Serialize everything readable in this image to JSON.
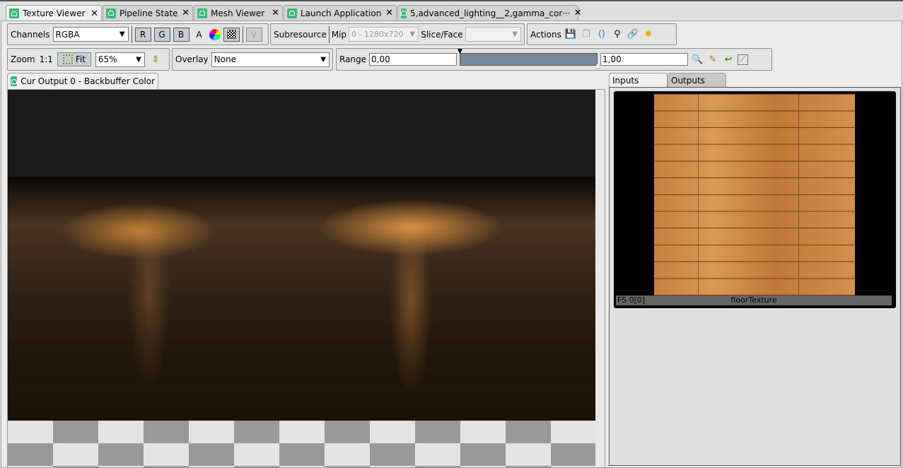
{
  "tabs": [
    {
      "label": "Texture Viewer",
      "active": true
    },
    {
      "label": "Pipeline State"
    },
    {
      "label": "Mesh Viewer"
    },
    {
      "label": "Launch Application"
    },
    {
      "label": "5,advanced_lighting__2,gamma_cor···"
    }
  ],
  "toolbar": {
    "channels_label": "Channels",
    "channels_value": "RGBA",
    "r": "R",
    "g": "G",
    "b": "B",
    "a": "A",
    "v": "v",
    "subresource_label": "Subresource",
    "mip_label": "Mip",
    "mip_value": "0 - 1280x720",
    "slice_label": "Slice/Face",
    "slice_value": "",
    "actions_label": "Actions",
    "zoom_label": "Zoom",
    "zoom_1to1": "1:1",
    "fit_label": "Fit",
    "zoom_value": "65%",
    "overlay_label": "Overlay",
    "overlay_value": "None",
    "range_label": "Range",
    "range_min": "0,00",
    "range_max": "1,00"
  },
  "viewer": {
    "tab_label": "Cur Output 0 - Backbuffer Color"
  },
  "side": {
    "tab_inputs": "Inputs",
    "tab_outputs": "Outputs",
    "thumb_slot": "FS 0[0]",
    "thumb_name": "floorTexture"
  },
  "colors": {
    "accent": "#3cb878",
    "range_bar": "#7a889f"
  }
}
